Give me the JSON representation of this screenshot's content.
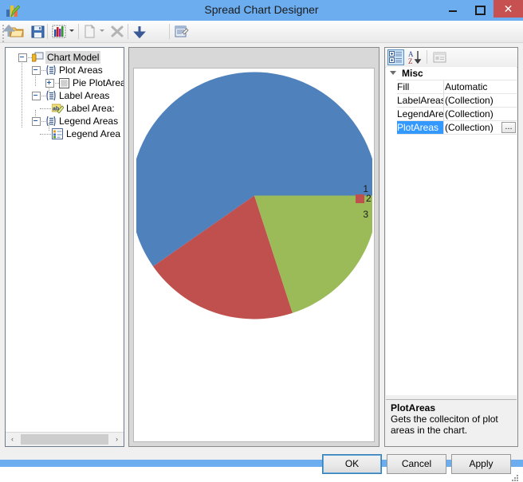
{
  "window": {
    "title": "Spread Chart Designer",
    "app_icon": "chart-pencil-icon",
    "minimize_label": "–",
    "maximize_label": "□",
    "close_label": "✕",
    "titlebar_color": "#6badef",
    "close_button_color": "#c75050"
  },
  "toolbar": {
    "items": [
      {
        "name": "open-button",
        "icon": "folder-open-icon",
        "enabled": true
      },
      {
        "name": "save-button",
        "icon": "floppy-disk-icon",
        "enabled": true
      },
      {
        "name": "new-chart-button",
        "icon": "bar-chart-icon",
        "enabled": true,
        "has_dropdown": true
      },
      {
        "name": "copy-button",
        "icon": "page-copy-icon",
        "enabled": false,
        "has_dropdown": true
      },
      {
        "name": "delete-button",
        "icon": "x-delete-icon",
        "enabled": false
      },
      {
        "name": "move-down-button",
        "icon": "arrow-down-icon",
        "enabled": true
      },
      {
        "name": "move-up-button",
        "icon": "arrow-up-icon",
        "enabled": true
      },
      {
        "name": "properties-button",
        "icon": "property-window-icon",
        "enabled": true
      }
    ]
  },
  "tree": {
    "items": [
      {
        "label": "Chart Model",
        "icon": "chart-model-icon",
        "depth": 0,
        "expander": "minus",
        "selected": true
      },
      {
        "label": "Plot Areas",
        "icon": "collection-icon",
        "depth": 1,
        "expander": "minus",
        "selected": false
      },
      {
        "label": "Pie PlotArea",
        "icon": "plot-area-icon",
        "depth": 2,
        "expander": "plus",
        "selected": false
      },
      {
        "label": "Label Areas",
        "icon": "collection-icon",
        "depth": 1,
        "expander": "minus",
        "selected": false
      },
      {
        "label": "Label Area:",
        "icon": "label-area-icon",
        "depth": 2,
        "expander": "none",
        "selected": false
      },
      {
        "label": "Legend Areas",
        "icon": "collection-icon",
        "depth": 1,
        "expander": "minus",
        "selected": false
      },
      {
        "label": "Legend Area (",
        "icon": "legend-area-icon",
        "depth": 2,
        "expander": "none",
        "selected": false
      }
    ],
    "scrollbar": {
      "left_arrow": "‹",
      "right_arrow": "›"
    }
  },
  "property_grid": {
    "toolbar": [
      {
        "name": "categorized-button",
        "icon": "categorized-icon",
        "pressed": true
      },
      {
        "name": "alphabetical-button",
        "icon": "sort-az-icon",
        "pressed": false
      },
      {
        "name": "property-pages-button",
        "icon": "property-pages-icon",
        "pressed": false,
        "enabled": false
      }
    ],
    "category": "Misc",
    "rows": [
      {
        "name": "Fill",
        "value": "Automatic",
        "selected": false,
        "has_editor_button": false
      },
      {
        "name": "LabelAreas",
        "value": "(Collection)",
        "selected": false,
        "has_editor_button": false
      },
      {
        "name": "LegendAre",
        "value": "(Collection)",
        "selected": false,
        "has_editor_button": false
      },
      {
        "name": "PlotAreas",
        "value": "(Collection)",
        "selected": true,
        "has_editor_button": true
      }
    ],
    "editor_button_label": "...",
    "description": {
      "title": "PlotAreas",
      "text": "Gets the colleciton of plot areas in the chart."
    },
    "selection_color": "#3399ff"
  },
  "chart_data": {
    "type": "pie",
    "title": "",
    "categories": [
      "1",
      "2",
      "3"
    ],
    "values": [
      59.7,
      20.3,
      20.0
    ],
    "start_angle_deg": 0,
    "direction": "counterclockwise",
    "slices": [
      {
        "label": "1",
        "color": "#4f81bd",
        "start_deg": 0,
        "end_deg": 215
      },
      {
        "label": "2",
        "color": "#c0504d",
        "start_deg": 215,
        "end_deg": 288
      },
      {
        "label": "3",
        "color": "#9bbb59",
        "start_deg": 288,
        "end_deg": 360
      }
    ],
    "legend": {
      "position": "right-inside",
      "entries": [
        {
          "label": "1",
          "show_swatch": false
        },
        {
          "label": "2",
          "show_swatch": true,
          "swatch_color": "#c0504d"
        },
        {
          "label": "3",
          "show_swatch": false
        }
      ]
    },
    "grid": false,
    "xlabel": "",
    "ylabel": ""
  },
  "buttons": {
    "ok": "OK",
    "cancel": "Cancel",
    "apply": "Apply"
  }
}
